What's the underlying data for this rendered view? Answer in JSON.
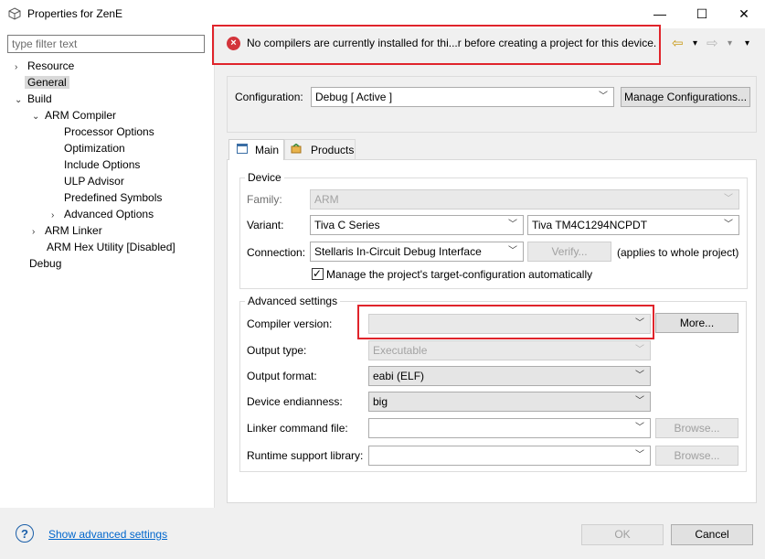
{
  "window": {
    "title": "Properties for ZenE",
    "minimize": "—",
    "maximize": "☐",
    "close": "✕"
  },
  "filter": {
    "placeholder": "type filter text"
  },
  "tree": [
    {
      "label": "Resource",
      "twisty": "›"
    },
    {
      "label": "General",
      "twisty": ""
    },
    {
      "label": "Build",
      "twisty": "⌄"
    },
    {
      "label": "ARM Compiler",
      "twisty": "⌄"
    },
    {
      "label": "Processor Options",
      "twisty": ""
    },
    {
      "label": "Optimization",
      "twisty": ""
    },
    {
      "label": "Include Options",
      "twisty": ""
    },
    {
      "label": "ULP Advisor",
      "twisty": ""
    },
    {
      "label": "Predefined Symbols",
      "twisty": ""
    },
    {
      "label": "Advanced Options",
      "twisty": "›"
    },
    {
      "label": "ARM Linker",
      "twisty": "›"
    },
    {
      "label": "ARM Hex Utility  [Disabled]",
      "twisty": ""
    },
    {
      "label": "Debug",
      "twisty": ""
    }
  ],
  "error": {
    "icon": "×",
    "message": "No compilers are currently installed for thi...r before creating a project for this device."
  },
  "nav": {
    "back": "⇦",
    "back_menu": "▾",
    "forward": "⇨",
    "forward_menu": "▾",
    "view_menu": "▾"
  },
  "configuration": {
    "label": "Configuration:",
    "value": "Debug  [ Active ]",
    "manage_button": "Manage Configurations..."
  },
  "tabs": [
    {
      "label": "Main"
    },
    {
      "label": "Products"
    }
  ],
  "device": {
    "group_title": "Device",
    "family_label": "Family:",
    "family_value": "ARM",
    "variant_label": "Variant:",
    "variant_series": "Tiva C Series",
    "variant_part": "Tiva TM4C1294NCPDT",
    "connection_label": "Connection:",
    "connection_value": "Stellaris In-Circuit Debug Interface",
    "verify_button": "Verify...",
    "connection_note": "(applies to whole project)",
    "manage_checkbox_label": "Manage the project's target-configuration automatically",
    "manage_checked": "✓"
  },
  "advanced": {
    "group_title": "Advanced settings",
    "compiler_label": "Compiler version:",
    "compiler_value": "",
    "more_button": "More...",
    "output_type_label": "Output type:",
    "output_type_value": "Executable",
    "output_format_label": "Output format:",
    "output_format_value": "eabi (ELF)",
    "endianness_label": "Device endianness:",
    "endianness_value": "big",
    "linker_cmd_label": "Linker command file:",
    "linker_cmd_value": "",
    "linker_browse": "Browse...",
    "rts_label": "Runtime support library:",
    "rts_value": "",
    "rts_browse": "Browse..."
  },
  "footer": {
    "help_icon": "?",
    "advanced_link": "Show advanced settings",
    "ok_button": "OK",
    "cancel_button": "Cancel"
  },
  "colors": {
    "error_red": "#e0242b",
    "link_blue": "#0066cc"
  }
}
